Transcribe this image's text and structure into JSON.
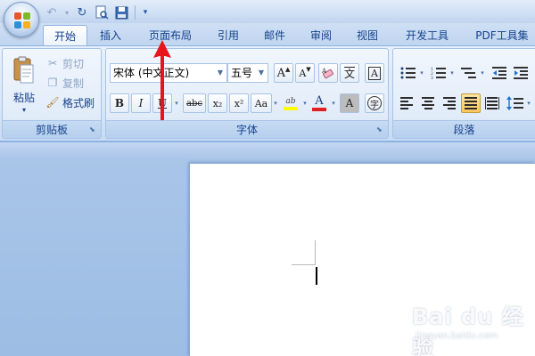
{
  "quick_access": {
    "icons": [
      "undo-icon",
      "redo-icon",
      "print-preview-icon",
      "save-icon",
      "customize-qat-icon"
    ]
  },
  "tabs": [
    {
      "label": "开始",
      "active": true
    },
    {
      "label": "插入"
    },
    {
      "label": "页面布局"
    },
    {
      "label": "引用"
    },
    {
      "label": "邮件"
    },
    {
      "label": "审阅"
    },
    {
      "label": "视图"
    },
    {
      "label": "开发工具"
    },
    {
      "label": "PDF工具集"
    }
  ],
  "clipboard": {
    "label": "剪贴板",
    "paste": "粘贴",
    "cut": "剪切",
    "copy": "复制",
    "format_painter": "格式刷"
  },
  "font": {
    "label": "字体",
    "font_name": "宋体 (中文正文)",
    "font_size": "五号",
    "buttons": {
      "bold": "B",
      "italic": "I",
      "underline": "U",
      "strikethrough": "abc",
      "subscript": "x₂",
      "superscript": "x²",
      "change_case": "Aa",
      "font_color": "A",
      "char_shading": "A",
      "phonetic": "文",
      "char_border": "A",
      "grow": "A",
      "shrink": "A",
      "highlight": "ab",
      "enclose": "字"
    },
    "colors": {
      "highlight": "#ffff00",
      "font_color": "#e02020"
    }
  },
  "paragraph": {
    "label": "段落"
  },
  "annotation": {
    "color": "#e8141b"
  },
  "watermark": {
    "main": "Bai du 经验",
    "sub": "jingyan.baidu.com"
  }
}
